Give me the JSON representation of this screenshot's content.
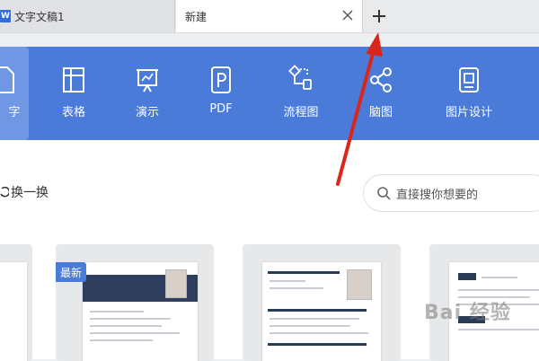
{
  "tabs": [
    {
      "label": "文字文稿1",
      "icon": "wps-writer-icon"
    },
    {
      "label": "新建",
      "icon": "close-icon"
    }
  ],
  "categories": [
    {
      "label": "字",
      "icon": "document-icon",
      "active": true
    },
    {
      "label": "表格",
      "icon": "table-icon",
      "active": false
    },
    {
      "label": "演示",
      "icon": "presentation-icon",
      "active": false
    },
    {
      "label": "PDF",
      "icon": "pdf-icon",
      "active": false
    },
    {
      "label": "流程图",
      "icon": "flowchart-icon",
      "active": false
    },
    {
      "label": "脑图",
      "icon": "mindmap-icon",
      "active": false
    },
    {
      "label": "图片设计",
      "icon": "image-design-icon",
      "active": false
    }
  ],
  "content": {
    "refresh_label": "换一换",
    "search_placeholder": "直接搜你想要的",
    "new_badge": "最新"
  },
  "watermark": "Bai 经验",
  "colors": {
    "toolbar": "#4a7bd9",
    "annotation_arrow": "#d9261c"
  }
}
